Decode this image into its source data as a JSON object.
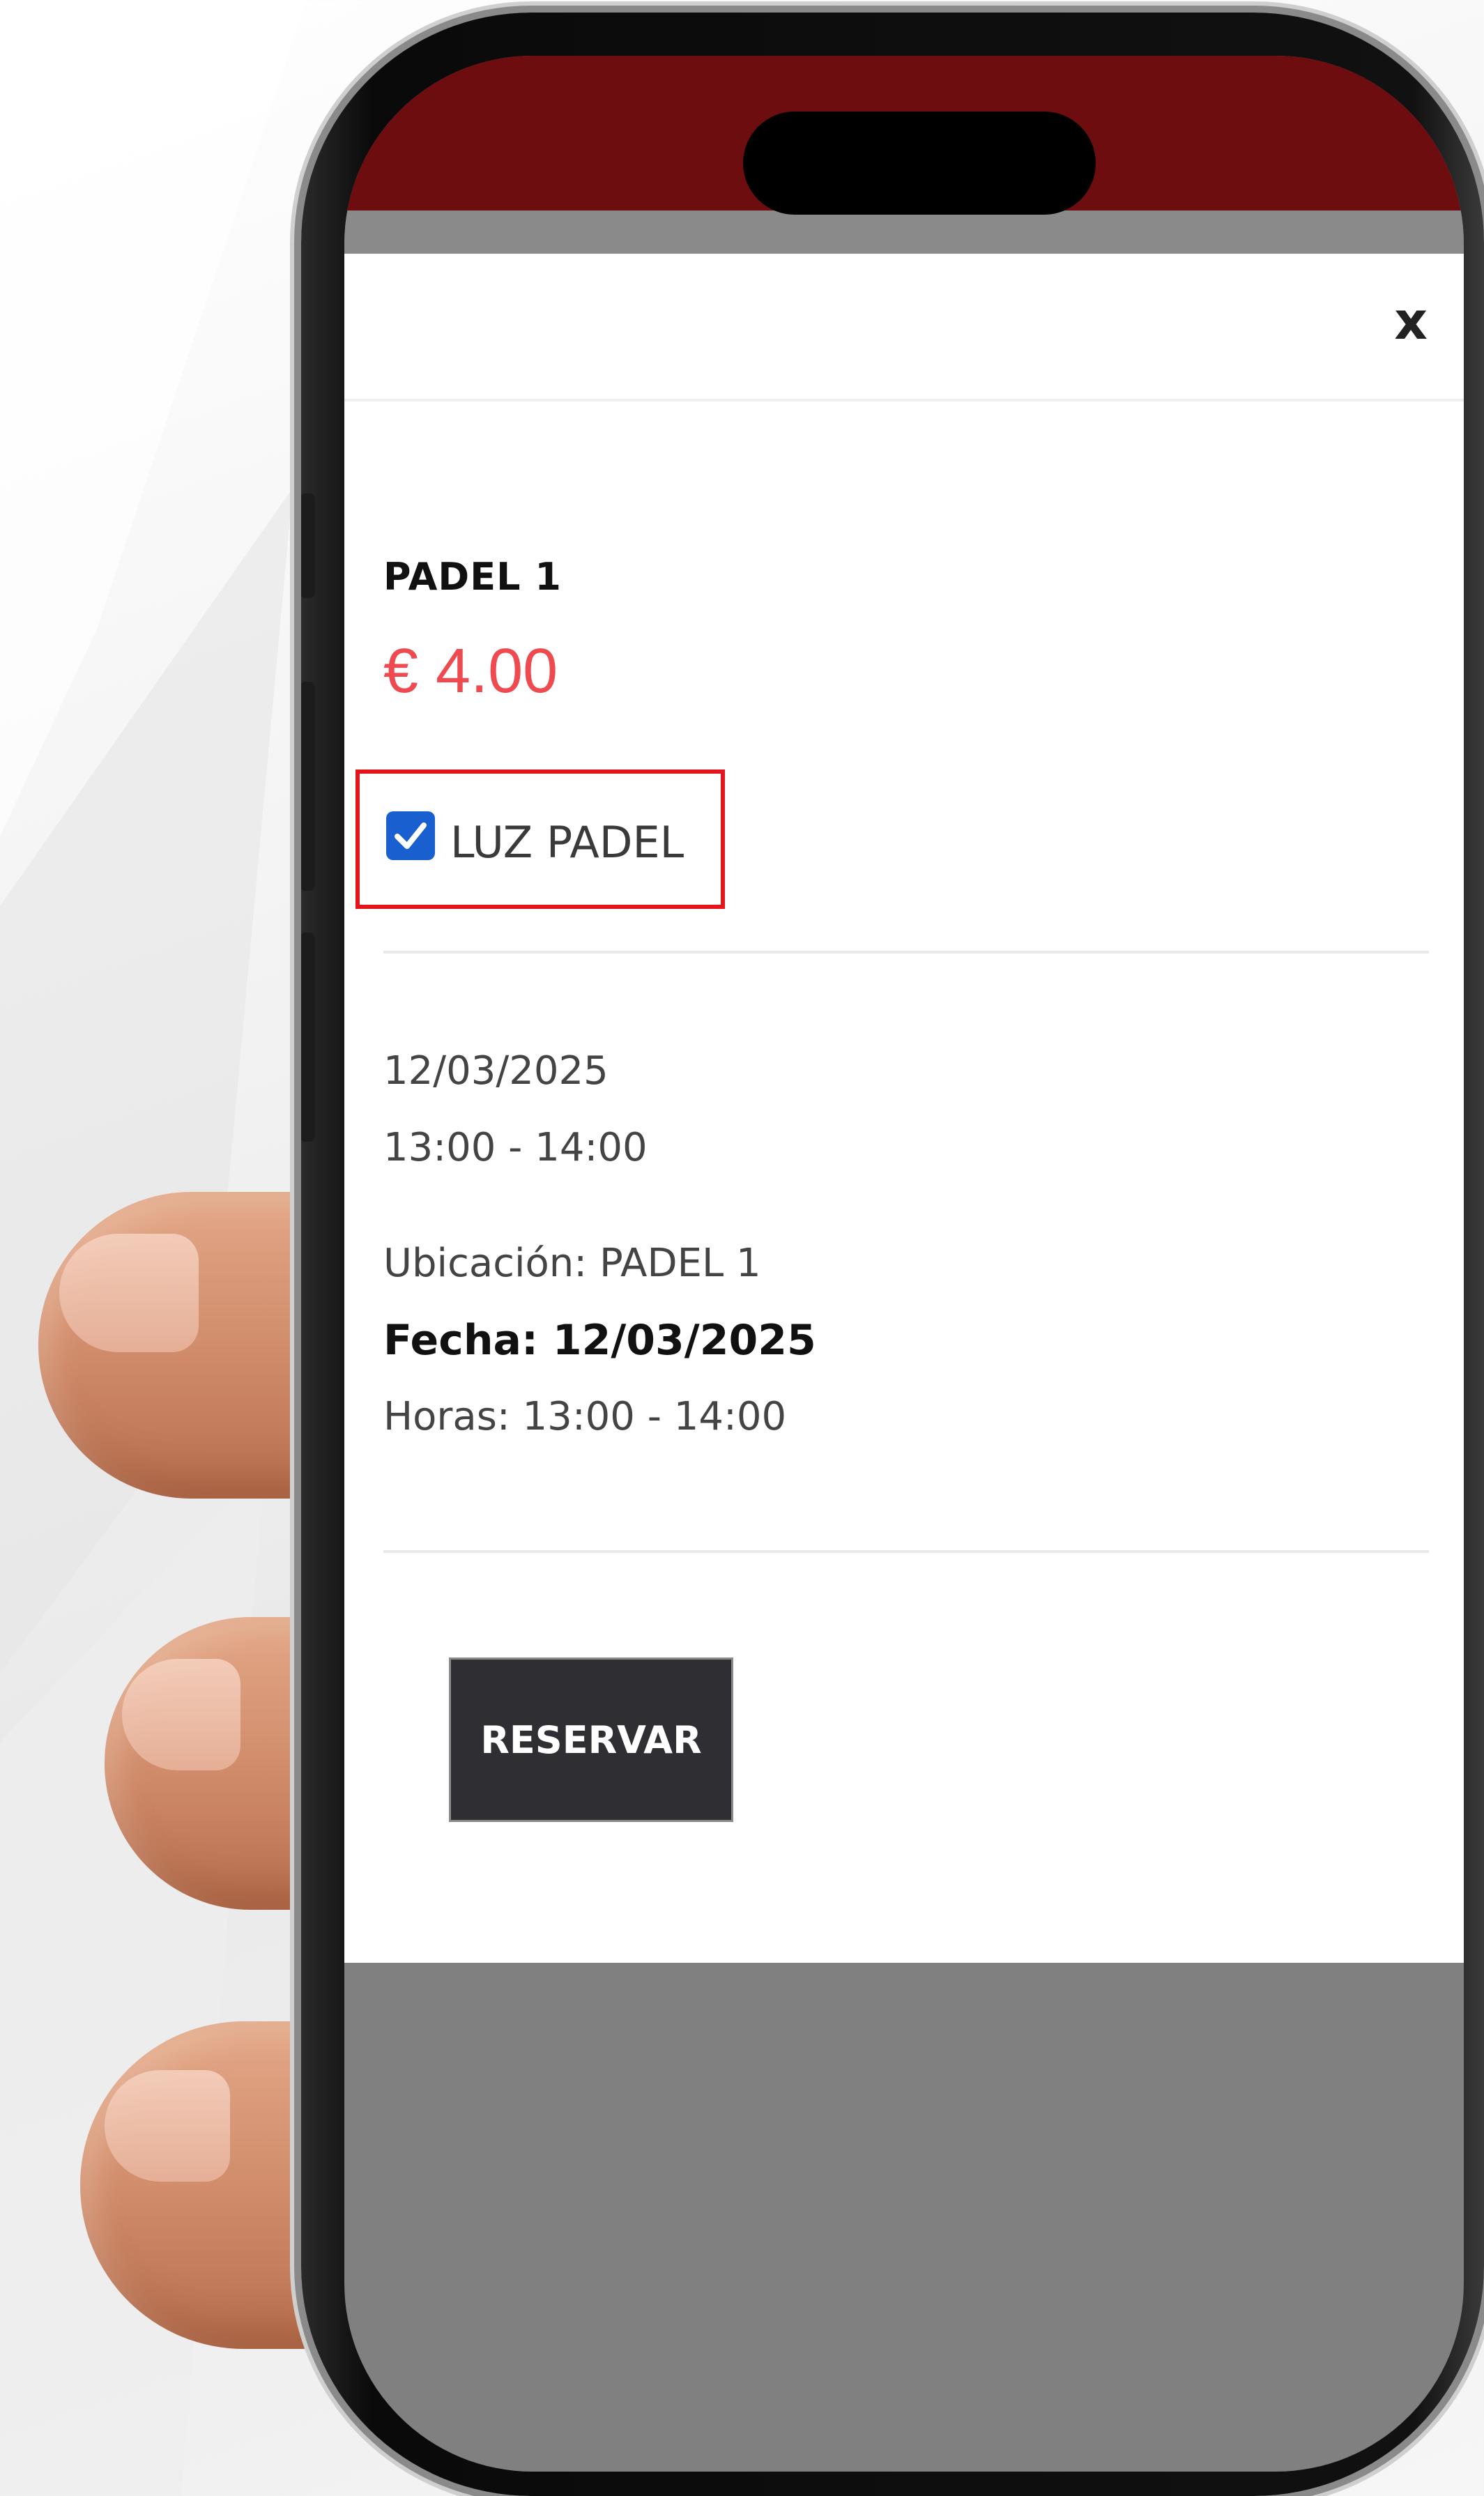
{
  "modal": {
    "close_label": "x",
    "item_title": "PADEL 1",
    "price": "€ 4.00",
    "option": {
      "label": "LUZ PADEL",
      "checked": true
    },
    "date": "12/03/2025",
    "time_range": "13:00 - 14:00",
    "location": "Ubicación: PADEL 1",
    "date_detail": "Fecha: 12/03/2025",
    "hours_detail": "Horas: 13:00 - 14:00",
    "reserve_label": "RESERVAR"
  },
  "colors": {
    "status_bar": "#6e0d10",
    "price_text": "#ee4a4f",
    "highlight_border": "#e4141b",
    "checkbox": "#1a5fd0",
    "button_bg": "#2e2e33",
    "overlay": "#808080"
  }
}
